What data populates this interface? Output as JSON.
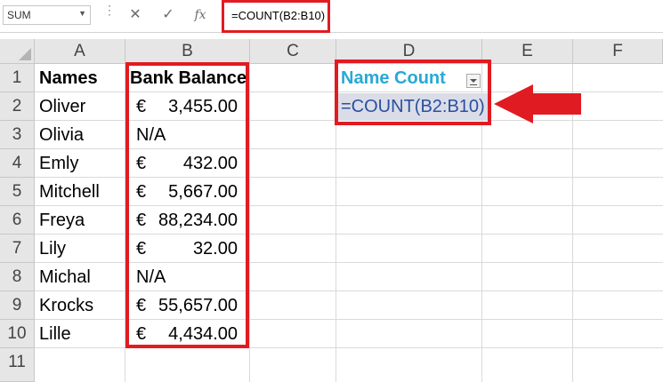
{
  "formula_bar": {
    "name_box": "SUM",
    "cancel_glyph": "✕",
    "enter_glyph": "✓",
    "fx_label": "fx",
    "formula": "=COUNT(B2:B10)"
  },
  "columns": [
    "A",
    "B",
    "C",
    "D",
    "E",
    "F"
  ],
  "rows": [
    "1",
    "2",
    "3",
    "4",
    "5",
    "6",
    "7",
    "8",
    "9",
    "10",
    "11"
  ],
  "sheet": {
    "header_names": "Names",
    "header_balance": "Bank Balance",
    "data": [
      {
        "name": "Oliver",
        "currency": "€",
        "amount": "3,455.00"
      },
      {
        "name": "Olivia",
        "currency": "",
        "amount": "N/A"
      },
      {
        "name": "Emly",
        "currency": "€",
        "amount": "432.00"
      },
      {
        "name": "Mitchell",
        "currency": "€",
        "amount": "5,667.00"
      },
      {
        "name": "Freya",
        "currency": "€",
        "amount": "88,234.00"
      },
      {
        "name": "Lily",
        "currency": "€",
        "amount": "32.00"
      },
      {
        "name": "Michal",
        "currency": "",
        "amount": "N/A"
      },
      {
        "name": "Krocks",
        "currency": "€",
        "amount": "55,657.00"
      },
      {
        "name": "Lille",
        "currency": "€",
        "amount": "4,434.00"
      }
    ],
    "name_count_header": "Name Count",
    "name_count_formula": "=COUNT(B2:B10)"
  },
  "colors": {
    "highlight": "#e11b22",
    "name_count_header": "#27a9d6",
    "formula_text": "#2b4f9e",
    "selection": "#dadde8"
  },
  "icons": {
    "arrow": "red-left-arrow-icon",
    "filter": "filter-dropdown-icon"
  }
}
